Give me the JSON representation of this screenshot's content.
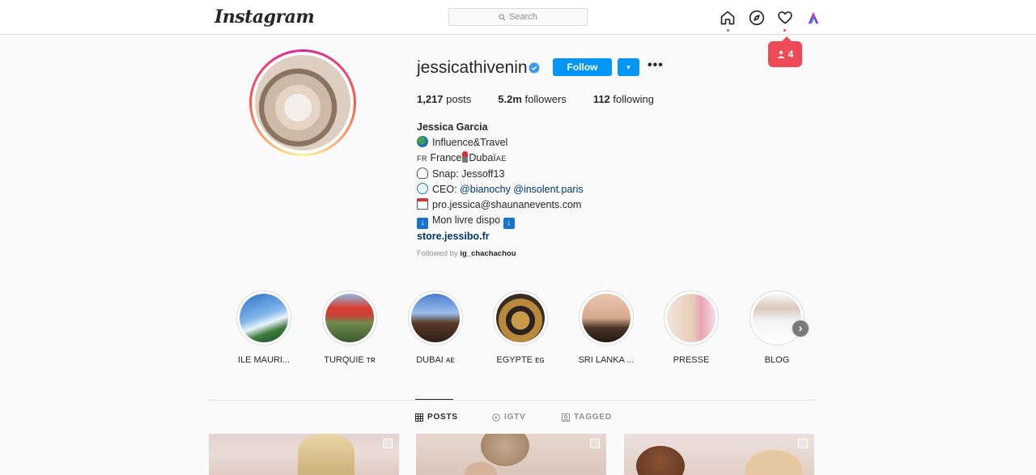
{
  "header": {
    "logo": "Instagram",
    "search_placeholder": "Search",
    "notification_count": "4"
  },
  "profile": {
    "username": "jessicathivenin",
    "follow_label": "Follow",
    "dropdown_label": "▾",
    "more_label": "•••",
    "stats": [
      {
        "value": "1,217",
        "label": "posts"
      },
      {
        "value": "5.2m",
        "label": "followers"
      },
      {
        "value": "112",
        "label": "following"
      }
    ],
    "bio": {
      "name": "Jessica Garcia",
      "line1": "Influence&Travel",
      "line2_flag_fr": "FR",
      "line2_france": "France",
      "line2_dubai": "Dubaï",
      "line2_flag_ae": "AE",
      "line3": "Snap: Jessoff13",
      "line4_prefix": "CEO: ",
      "line4_tag1": "@bianochy",
      "line4_tag2": "@insolent.paris",
      "line5": "pro.jessica@shaunanevents.com",
      "line6": "Mon livre dispo",
      "link": "store.jessibo.fr"
    },
    "followed_by_prefix": "Followed by ",
    "followed_by_user": "ig_chachachou"
  },
  "highlights": [
    {
      "label": "ILE MAURI..."
    },
    {
      "label": "TURQUIE ᴛʀ"
    },
    {
      "label": "DUBAI ᴀᴇ"
    },
    {
      "label": "EGYPTE ᴇɢ"
    },
    {
      "label": "SRI LANKA ..."
    },
    {
      "label": "PRESSE"
    },
    {
      "label": "BLOG"
    }
  ],
  "tabs": [
    {
      "label": "POSTS"
    },
    {
      "label": "IGTV"
    },
    {
      "label": "TAGGED"
    }
  ],
  "colors": {
    "accent": "#0095f6",
    "notification": "#ed4956",
    "link": "#00376b"
  }
}
